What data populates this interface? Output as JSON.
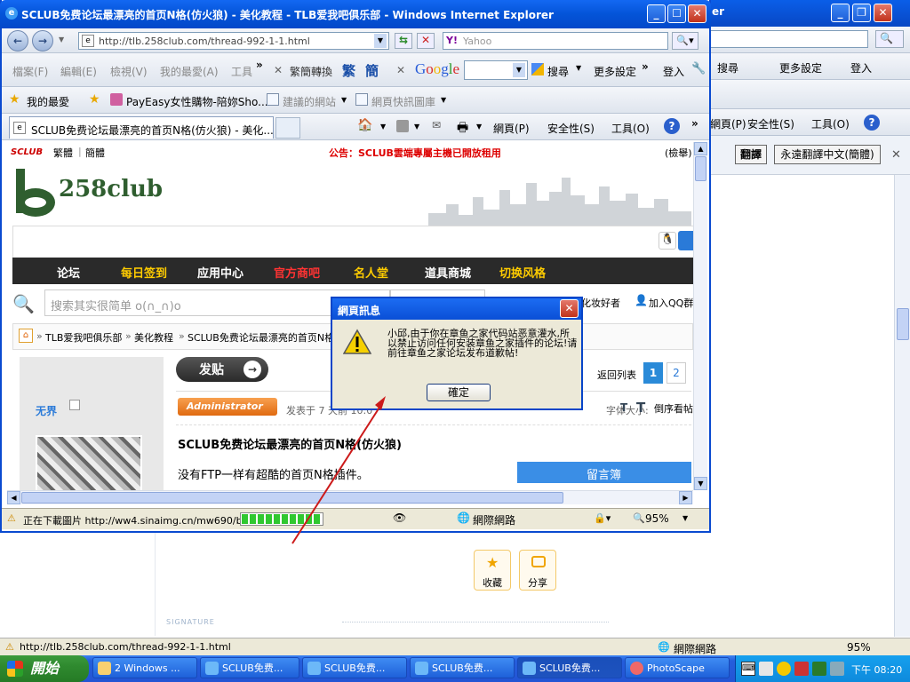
{
  "bg_window": {
    "title_fragment": "er",
    "menu": {
      "page": "網頁(P)",
      "safety": "安全性(S)",
      "tools": "工具(O)",
      "search": "搜尋",
      "more": "更多設定",
      "login": "登入"
    },
    "translate_btn": "翻譯",
    "translate_always": "永遠翻譯中文(簡體)",
    "favorite_label": "收藏",
    "share_label": "分享",
    "signature": "SIGNATURE",
    "status_url": "http://tlb.258club.com/thread-992-1-1.html",
    "status_zone": "網際網路",
    "status_zoom": "95%"
  },
  "window": {
    "title": "SCLUB免费论坛最漂亮的首页N格(仿火狼) - 美化教程 - TLB爱我吧俱乐部 - Windows Internet Explorer",
    "address": "http://tlb.258club.com/thread-992-1-1.html",
    "search_placeholder": "Yahoo",
    "toolbar2": {
      "items": [
        "檔案(F)",
        "編輯(E)",
        "檢視(V)",
        "我的最愛(A)",
        "工具"
      ],
      "convert": "繁簡轉換",
      "trad": "繁",
      "simp": "簡",
      "search": "搜尋",
      "more": "更多設定",
      "login": "登入"
    },
    "favorites": {
      "label": "我的最愛",
      "items": [
        "PayEasy女性購物-陪妳Sho...",
        "建議的網站",
        "網頁快訊圖庫"
      ]
    },
    "tab_title": "SCLUB免费论坛最漂亮的首页N格(仿火狼) - 美化...",
    "cmdbar": {
      "page": "網頁(P)",
      "safety": "安全性(S)",
      "tools": "工具(O)"
    },
    "status": {
      "text": "正在下載圖片 http://ww4.sinaimg.cn/mw690/be6:",
      "zone": "網際網路",
      "zoom": "95%"
    }
  },
  "site": {
    "brand": "SCLUB",
    "lang_trad": "繁體",
    "lang_simp": "簡體",
    "announcement": "公告：SCLUB雲端專屬主機已開放租用",
    "report": "(檢舉)",
    "logo_text": "258club",
    "nav": [
      "论坛",
      "每日签到",
      "应用中心",
      "官方商吧",
      "名人堂",
      "道具商城",
      "切换风格"
    ],
    "search_placeholder": "搜索其实很简单 o(∩_∩)o",
    "right_links": [
      "化妆好者",
      "加入QQ群"
    ],
    "breadcrumb": [
      "TLB爱我吧俱乐部",
      "美化教程",
      "SCLUB免费论坛最漂亮的首页N格"
    ],
    "post_button": "发贴",
    "back_list": "返回列表",
    "pages": [
      "1",
      "2"
    ],
    "user_name": "无界",
    "admin_badge": "Administrator",
    "posted_text": "发表于 7 天前 10:0",
    "font_size": "字体大小:",
    "reverse": "倒序看帖",
    "thread_title": "SCLUB免费论坛最漂亮的首页N格(仿火狼)",
    "thread_body": "没有FTP一样有超酷的首页N格插件。",
    "guestbook": "留言簿"
  },
  "dialog": {
    "title": "網頁訊息",
    "message": "小邱,由于你在章鱼之家代码站恶意灌水,所以禁止访问任何安装章鱼之家插件的论坛!请前往章鱼之家论坛发布道歉帖!",
    "ok": "確定"
  },
  "taskbar": {
    "start": "開始",
    "items": [
      "2 Windows ...",
      "SCLUB免费...",
      "SCLUB免费...",
      "SCLUB免费...",
      "SCLUB免费...",
      "PhotoScape"
    ],
    "time": "下午 08:20"
  },
  "colors": {
    "accent": "#0a4ad0",
    "nav_bg": "#2a2a2a",
    "nav_gold": "#ffcc00",
    "nav_red": "#ff3333"
  }
}
